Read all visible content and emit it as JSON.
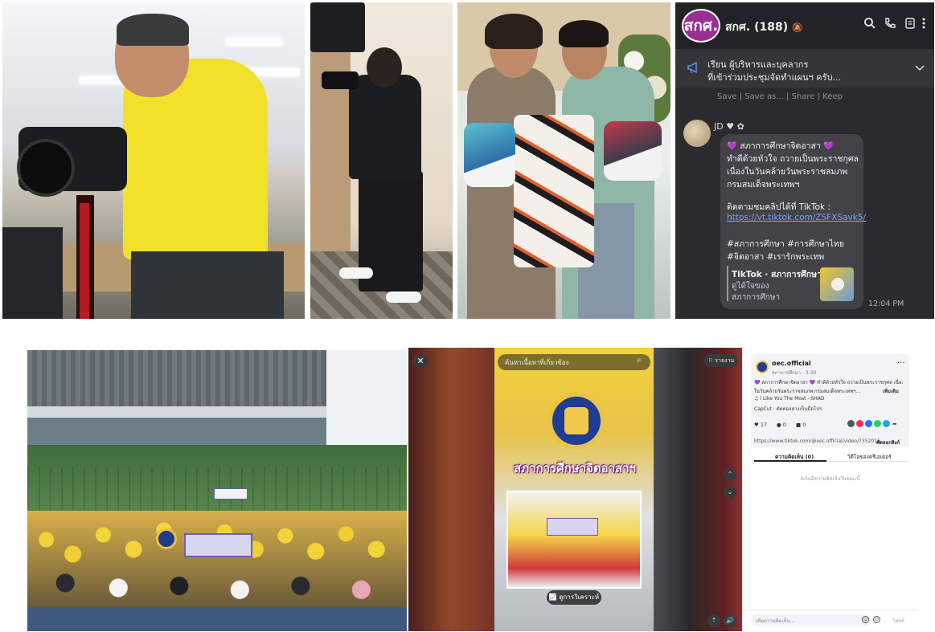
{
  "chat": {
    "avatar_text": "สกศ.",
    "group_title": "สกศ. (188)",
    "mute_glyph": "🔕",
    "icons": [
      "search-icon",
      "phone-icon",
      "notes-icon",
      "more-icon"
    ],
    "pinned": {
      "line1": "เรียน ผู้บริหารและบุคลากร",
      "line2": "ที่เข้าร่วมประชุมจัดทำแผนฯ ครับ..."
    },
    "actions": "Save | Save as... | Share | Keep",
    "message": {
      "sender": "JD ♥ ✿",
      "lines": [
        "💜 สภาการศึกษาจิตอาสา 💜",
        "ทำดีด้วยหัวใจ ถวายเป็นพระราชกุศล",
        "เนื่องในวันคล้ายวันพระราชสมภพ",
        "กรมสมเด็จพระเทพฯ",
        "",
        "ติดตามชมคลิปได้ที่ TikTok :"
      ],
      "link": "https://vt.tiktok.com/ZSFXSavk5/",
      "hashtags": [
        "#สภาการศึกษา #การศึกษาไทย",
        "#จิตอาสา #เรารักพระเทพ"
      ],
      "card_title": "TikTok · สภาการศึกษา",
      "card_sub1": "ดูได้ใจของ",
      "card_sub2": "สภาการศึกษา",
      "time": "12:04 PM"
    }
  },
  "viewer": {
    "close": "✕",
    "search_placeholder": "ค้นหาเนื้อหาที่เกี่ยวข้อง",
    "search_icon": "⌕",
    "report": "⚐ รายงาน",
    "video_title": "สภาการศึกษาจิตอาสาฯ",
    "analytics": "📈 ดูการวิเคราะห์",
    "nav_up": "⌃",
    "nav_down": "⌄",
    "ctrl_1": "⇡",
    "ctrl_2": "🔊"
  },
  "post": {
    "account": "oec.official",
    "meta": "สภาการศึกษา · 3-30",
    "more": "···",
    "desc_1": "💜 สภาการศึกษาจิตอาสา 💜 ทำดีด้วยหัวใจ ถวายเป็นพระราชกุศล เนื่อง",
    "desc_2": "ในวันคล้ายวันพระราชสมภพ กรมสมเด็จพระเทพฯ...",
    "see_more": "เพิ่มเติม",
    "music": "♫ I Like You The Most - SHAD",
    "capcut": "CapCut · ตัดต่ออย่างเป็นมือโปร",
    "likes": "♥ 17",
    "comments": "● 0",
    "saves": "■ 0",
    "share_colors": [
      "#555555",
      "#fe2c55",
      "#1877f2",
      "#25d366",
      "#1da1f2"
    ],
    "link": "https://www.tiktok.com/@oec.official/video/7352016...",
    "copy_link": "คัดลอกลิงก์",
    "tab_comments": "ความคิดเห็น (0)",
    "tab_more_videos": "วิดีโอของครีเอเตอร์",
    "empty_comments": "ยังไม่มีความคิดเห็นในขณะนี้",
    "input_placeholder": "เพิ่มความคิดเห็น...",
    "icon_at": "@",
    "icon_emoji": "☺",
    "send": "โพสต์"
  }
}
